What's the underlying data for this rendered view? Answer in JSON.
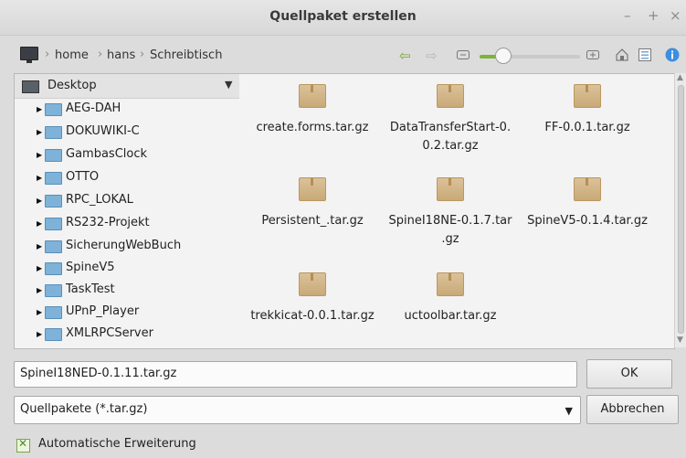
{
  "window": {
    "title": "Quellpaket erstellen",
    "controls": {
      "minimize": "–",
      "maximize": "+",
      "close": "×"
    }
  },
  "toolbar": {
    "breadcrumbs": [
      "home",
      "hans",
      "Schreibtisch"
    ],
    "separator": "›",
    "zoom_level": 0.23,
    "icons": [
      "computer-icon",
      "back-arrow-icon",
      "forward-arrow-icon",
      "zoom-out-icon",
      "zoom-in-icon",
      "home-folder-icon",
      "list-view-icon",
      "info-icon"
    ],
    "accent": "#7eb33a"
  },
  "sidebar": {
    "header": "Desktop",
    "items": [
      "AEG-DAH",
      "DOKUWIKI-C",
      "GambasClock",
      "OTTO",
      "RPC_LOKAL",
      "RS232-Projekt",
      "SicherungWebBuch",
      "SpineV5",
      "TaskTest",
      "UPnP_Player",
      "XMLRPCServer"
    ]
  },
  "files": [
    {
      "line1": "create.forms.tar.gz",
      "line2": ""
    },
    {
      "line1": "DataTransferStart-0.",
      "line2": "0.2.tar.gz"
    },
    {
      "line1": "FF-0.0.1.tar.gz",
      "line2": ""
    },
    {
      "line1": "Persistent_.tar.gz",
      "line2": ""
    },
    {
      "line1": "SpineI18NE-0.1.7.tar",
      "line2": ".gz"
    },
    {
      "line1": "SpineV5-0.1.4.tar.gz",
      "line2": ""
    },
    {
      "line1": "trekkicat-0.0.1.tar.gz",
      "line2": ""
    },
    {
      "line1": "uctoolbar.tar.gz",
      "line2": ""
    }
  ],
  "filename": {
    "value": "SpineI18NED-0.1.11.tar.gz"
  },
  "filter": {
    "value": "Quellpakete (*.tar.gz)"
  },
  "buttons": {
    "ok": "OK",
    "cancel": "Abbrechen"
  },
  "option": {
    "label": "Automatische Erweiterung",
    "checked": true
  }
}
